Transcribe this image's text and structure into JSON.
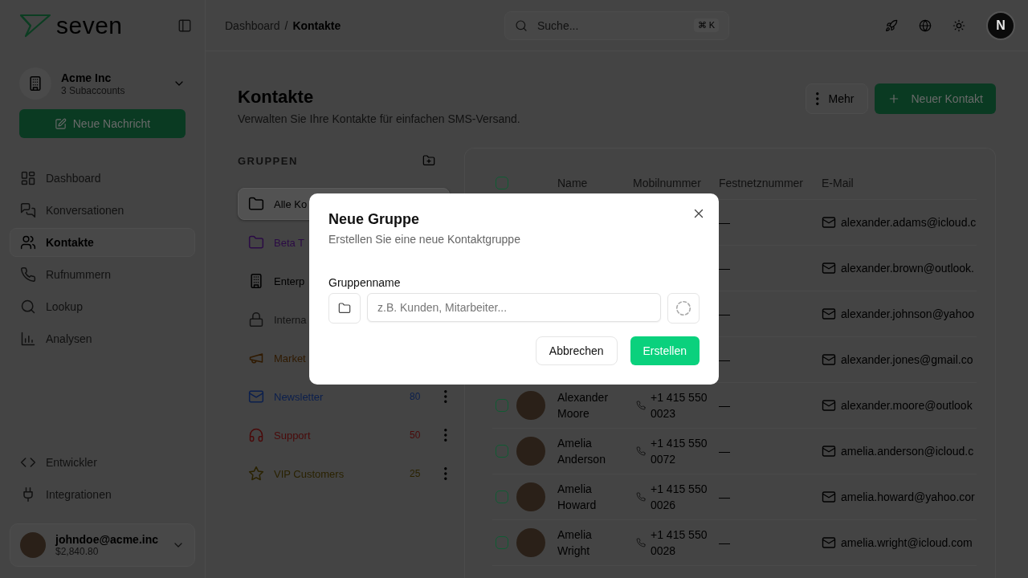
{
  "sidebar": {
    "logo": "seven",
    "account": {
      "name": "Acme Inc",
      "subtitle": "3 Subaccounts"
    },
    "new_message_button": "Neue Nachricht",
    "nav_items": [
      {
        "label": "Dashboard",
        "selected": false
      },
      {
        "label": "Konversationen",
        "selected": false
      },
      {
        "label": "Kontakte",
        "selected": true
      },
      {
        "label": "Rufnummern",
        "selected": false
      },
      {
        "label": "Lookup",
        "selected": false
      },
      {
        "label": "Analysen",
        "selected": false
      }
    ],
    "bottom_items": [
      {
        "label": "Entwickler",
        "selected": false
      },
      {
        "label": "Integrationen",
        "selected": false
      }
    ],
    "user": {
      "email": "johndoe@acme.inc",
      "balance": "$2,840.80"
    }
  },
  "topbar": {
    "breadcrumb": [
      "Dashboard",
      "Kontakte"
    ],
    "separator": "/",
    "search": {
      "placeholder": "Suche...",
      "shortcut": "⌘ K"
    },
    "avatar_letter": "N"
  },
  "page": {
    "title": "Kontakte",
    "subtitle": "Verwalten Sie Ihre Kontakte für einfachen SMS-Versand.",
    "more_button": "Mehr",
    "new_contact_button": "Neuer Kontakt"
  },
  "groups": {
    "heading": "GRUPPEN",
    "items": [
      {
        "label": "Alle Ko",
        "color": "#000000",
        "selected": true
      },
      {
        "label": "Beta T",
        "color": "#2b0b45",
        "selected": false
      },
      {
        "label": "Enterp",
        "color": "#000000",
        "selected": false
      },
      {
        "label": "Interna",
        "color": "#151515",
        "selected": false
      },
      {
        "label": "Market",
        "color": "#301a00",
        "selected": false
      },
      {
        "label": "Newsletter",
        "count": "80",
        "color": "#0b1f4d",
        "selected": false
      },
      {
        "label": "Support",
        "count": "50",
        "color": "#4a0a0a",
        "selected": false
      },
      {
        "label": "VIP Customers",
        "count": "25",
        "color": "#2a2200",
        "selected": false
      }
    ]
  },
  "table": {
    "columns": [
      "Name",
      "Mobilnummer",
      "Festnetznummer",
      "E-Mail"
    ],
    "select_all_checked": false,
    "rows": [
      {
        "landline": "—",
        "email": "alexander.adams@icloud.c"
      },
      {
        "landline": "—",
        "email": "alexander.brown@outlook."
      },
      {
        "landline": "—",
        "email": "alexander.johnson@yahoo"
      },
      {
        "landline": "—",
        "email": "alexander.jones@gmail.co"
      },
      {
        "name": "Alexander Moore",
        "mobile": "+1 415 550 0023",
        "landline": "—",
        "email": "alexander.moore@outlook",
        "photo": true,
        "checked": false
      },
      {
        "name": "Amelia Anderson",
        "mobile": "+1 415 550 0072",
        "landline": "—",
        "email": "amelia.anderson@icloud.c",
        "photo": true,
        "checked": false
      },
      {
        "name": "Amelia Howard",
        "mobile": "+1 415 550 0026",
        "landline": "—",
        "email": "amelia.howard@yahoo.cor",
        "photo": true,
        "checked": false
      },
      {
        "name": "Amelia Wright",
        "mobile": "+1 415 550 0028",
        "landline": "—",
        "email": "amelia.wright@icloud.com",
        "photo": true,
        "checked": false
      }
    ]
  },
  "dialog": {
    "title": "Neue Gruppe",
    "subtitle": "Erstellen Sie eine neue Kontaktgruppe",
    "field_label": "Gruppenname",
    "placeholder": "z.B. Kunden, Mitarbeiter...",
    "cancel_button": "Abbrechen",
    "create_button": "Erstellen"
  }
}
